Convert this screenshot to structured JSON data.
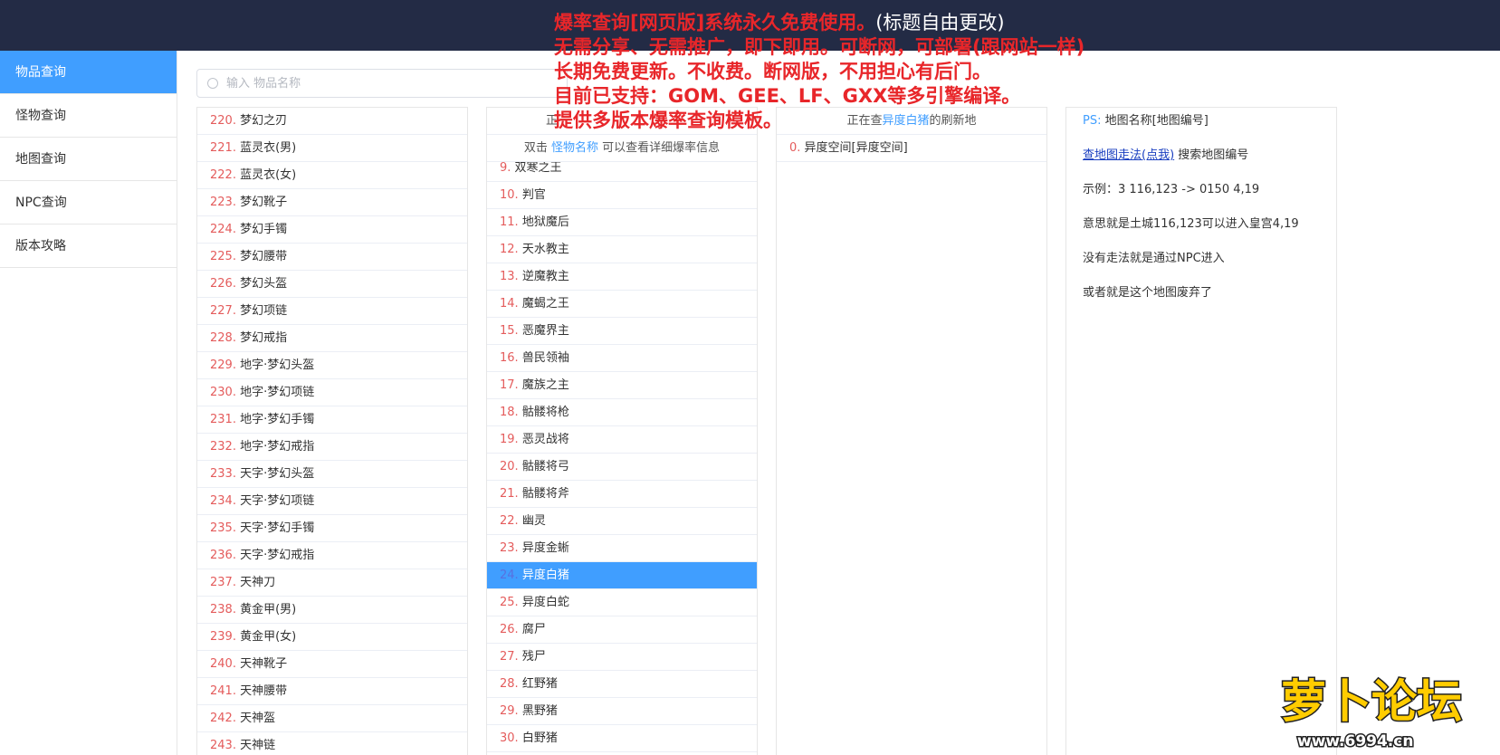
{
  "banner": {
    "lines": [
      {
        "red": "爆率查询[网页版]系统永久免费使用。",
        "white": "(标题自由更改)"
      },
      {
        "red": "无需分享、无需推广，即下即用。可断网，可部署(跟网站一样)",
        "white": ""
      },
      {
        "red": "长期免费更新。不收费。断网版，不用担心有后门。",
        "white": ""
      },
      {
        "red": "目前已支持：GOM、GEE、LF、GXX等多引擎编译。",
        "white": ""
      },
      {
        "red": "提供多版本爆率查询模板。",
        "white": ""
      }
    ]
  },
  "sidebar": {
    "items": [
      {
        "label": "物品查询",
        "active": true
      },
      {
        "label": "怪物查询",
        "active": false
      },
      {
        "label": "地图查询",
        "active": false
      },
      {
        "label": "NPC查询",
        "active": false
      },
      {
        "label": "版本攻略",
        "active": false
      }
    ]
  },
  "search": {
    "placeholder": "输入 物品名称",
    "value": ""
  },
  "items_list": [
    {
      "num": "220",
      "name": "梦幻之刃"
    },
    {
      "num": "221",
      "name": "蓝灵衣(男)"
    },
    {
      "num": "222",
      "name": "蓝灵衣(女)"
    },
    {
      "num": "223",
      "name": "梦幻靴子"
    },
    {
      "num": "224",
      "name": "梦幻手镯"
    },
    {
      "num": "225",
      "name": "梦幻腰带"
    },
    {
      "num": "226",
      "name": "梦幻头盔"
    },
    {
      "num": "227",
      "name": "梦幻项链"
    },
    {
      "num": "228",
      "name": "梦幻戒指"
    },
    {
      "num": "229",
      "name": "地字·梦幻头盔"
    },
    {
      "num": "230",
      "name": "地字·梦幻项链"
    },
    {
      "num": "231",
      "name": "地字·梦幻手镯"
    },
    {
      "num": "232",
      "name": "地字·梦幻戒指"
    },
    {
      "num": "233",
      "name": "天字·梦幻头盔"
    },
    {
      "num": "234",
      "name": "天字·梦幻项链"
    },
    {
      "num": "235",
      "name": "天字·梦幻手镯"
    },
    {
      "num": "236",
      "name": "天字·梦幻戒指"
    },
    {
      "num": "237",
      "name": "天神刀"
    },
    {
      "num": "238",
      "name": "黄金甲(男)"
    },
    {
      "num": "239",
      "name": "黄金甲(女)"
    },
    {
      "num": "240",
      "name": "天神靴子"
    },
    {
      "num": "241",
      "name": "天神腰带"
    },
    {
      "num": "242",
      "name": "天神盔"
    },
    {
      "num": "243",
      "name": "天神链"
    }
  ],
  "monster_panel": {
    "header_prefix": "正",
    "hint_before": "双击 ",
    "hint_link": "怪物名称",
    "hint_after": " 可以查看详细爆率信息",
    "rows": [
      {
        "num": "9",
        "name": "双寒之王"
      },
      {
        "num": "10",
        "name": "判官"
      },
      {
        "num": "11",
        "name": "地狱魔后"
      },
      {
        "num": "12",
        "name": "天水教主"
      },
      {
        "num": "13",
        "name": "逆魔教主"
      },
      {
        "num": "14",
        "name": "魔蝎之王"
      },
      {
        "num": "15",
        "name": "恶魔界主"
      },
      {
        "num": "16",
        "name": "兽民领袖"
      },
      {
        "num": "17",
        "name": "魔族之主"
      },
      {
        "num": "18",
        "name": "骷髅将枪"
      },
      {
        "num": "19",
        "name": "恶灵战将"
      },
      {
        "num": "20",
        "name": "骷髅将弓"
      },
      {
        "num": "21",
        "name": "骷髅将斧"
      },
      {
        "num": "22",
        "name": "幽灵"
      },
      {
        "num": "23",
        "name": "异度金蜥"
      },
      {
        "num": "24",
        "name": "异度白猪",
        "selected": true
      },
      {
        "num": "25",
        "name": "异度白蛇"
      },
      {
        "num": "26",
        "name": "腐尸"
      },
      {
        "num": "27",
        "name": "残尸"
      },
      {
        "num": "28",
        "name": "红野猪"
      },
      {
        "num": "29",
        "name": "黑野猪"
      },
      {
        "num": "30",
        "name": "白野猪"
      }
    ]
  },
  "refresh_panel": {
    "header_before": "正在查",
    "header_link": "异度白猪",
    "header_after": "的刷新地",
    "rows": [
      {
        "num": "0",
        "name": "异度空间[异度空间]"
      }
    ]
  },
  "info_panel": {
    "ps_label": "PS:",
    "ps_text": " 地图名称[地图编号]",
    "link_text": "查地图走法(点我)",
    "link_after": " 搜索地图编号",
    "example": "示例：3 116,123 -> 0150 4,19",
    "meaning": "意思就是土城116,123可以进入皇宫4,19",
    "no_route": "没有走法就是通过NPC进入",
    "abandoned": "或者就是这个地图废弃了"
  },
  "watermark": {
    "text": "萝卜论坛",
    "url": "www.6994.cn"
  }
}
